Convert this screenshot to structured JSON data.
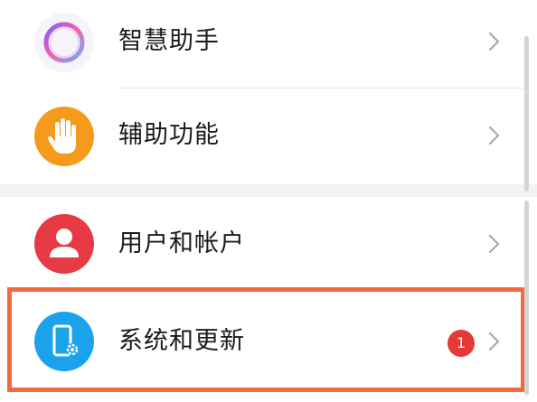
{
  "settings": {
    "items": [
      {
        "id": "smart-assistant",
        "label": "智慧助手",
        "icon": "smart-assistant-ring-icon"
      },
      {
        "id": "accessibility",
        "label": "辅助功能",
        "icon": "hand-icon"
      },
      {
        "id": "users-accounts",
        "label": "用户和帐户",
        "icon": "user-icon"
      },
      {
        "id": "system-update",
        "label": "系统和更新",
        "icon": "phone-settings-icon",
        "badge": "1",
        "highlighted": true
      }
    ]
  },
  "colors": {
    "accessibility_icon_bg": "#f59a1c",
    "users_icon_bg": "#e83a44",
    "system_icon_bg": "#1aa2ea",
    "badge_bg": "#e53935",
    "highlight_border": "#f36b3c"
  }
}
